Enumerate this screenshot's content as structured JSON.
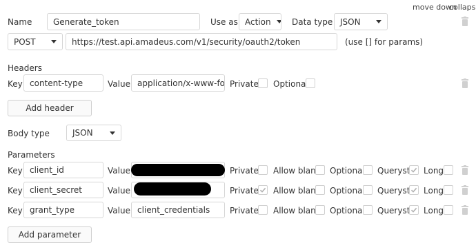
{
  "top_links": {
    "move_down": "move down",
    "collapse": "collapse"
  },
  "call": {
    "name_label": "Name",
    "name_value": "Generate_token",
    "use_as_label": "Use as",
    "use_as_value": "Action",
    "data_type_label": "Data type",
    "data_type_value": "JSON",
    "method_value": "POST",
    "url_value": "https://test.api.amadeus.com/v1/security/oauth2/token",
    "url_hint": "(use [] for params)"
  },
  "headers": {
    "title": "Headers",
    "key_label": "Key",
    "value_label": "Value",
    "private_label": "Private",
    "optional_label": "Optional",
    "rows": [
      {
        "key": "content-type",
        "value": "application/x-www-form-u",
        "private": false,
        "optional": false
      }
    ],
    "add_button": "Add header"
  },
  "body": {
    "type_label": "Body type",
    "type_value": "JSON"
  },
  "parameters": {
    "title": "Parameters",
    "key_label": "Key",
    "value_label": "Value",
    "private_label": "Private",
    "allow_blank_label": "Allow blank",
    "optional_label": "Optional",
    "queryst_label": "Queryst.",
    "long_label": "Long",
    "rows": [
      {
        "key": "client_id",
        "value": "",
        "redacted": true,
        "private": false,
        "allow_blank": false,
        "optional": false,
        "queryst": true,
        "long": false
      },
      {
        "key": "client_secret",
        "value": "",
        "redacted": true,
        "private": true,
        "allow_blank": false,
        "optional": false,
        "queryst": true,
        "long": false
      },
      {
        "key": "grant_type",
        "value": "client_credentials",
        "redacted": false,
        "private": false,
        "allow_blank": false,
        "optional": false,
        "queryst": true,
        "long": false
      }
    ],
    "add_button": "Add parameter"
  }
}
